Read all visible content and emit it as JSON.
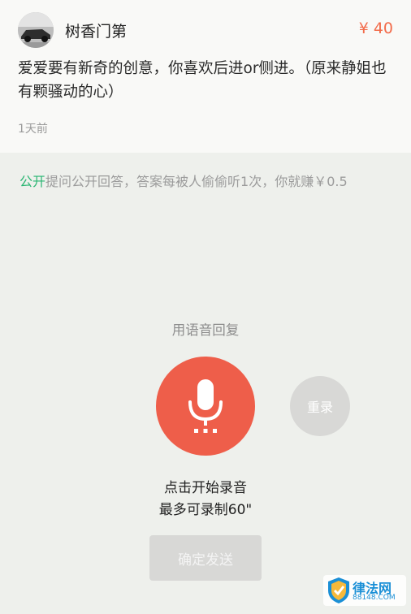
{
  "question": {
    "username": "树香门第",
    "price": "¥ 40",
    "text": "爱爱要有新奇的创意，你喜欢后进or侧进。（原来静姐也有颗骚动的心）",
    "time": "1天前"
  },
  "public_note": {
    "highlight": "公开",
    "text": "提问公开回答，答案每被人偷偷听1次，你就赚￥0.5"
  },
  "reply": {
    "title": "用语音回复",
    "rerecord_label": "重录",
    "hint_start": "点击开始录音",
    "hint_limit": "最多可录制60\"",
    "send_label": "确定发送"
  },
  "watermark": {
    "brand": "律法网",
    "sub": "88148.COM"
  },
  "colors": {
    "accent_red": "#ee5e4a",
    "price": "#f26b4a",
    "public_green": "#2bb673",
    "disabled_gray": "#d8d8d6"
  },
  "icons": {
    "record": "microphone-icon",
    "avatar": "car-photo-avatar",
    "watermark": "shield-logo-icon"
  }
}
